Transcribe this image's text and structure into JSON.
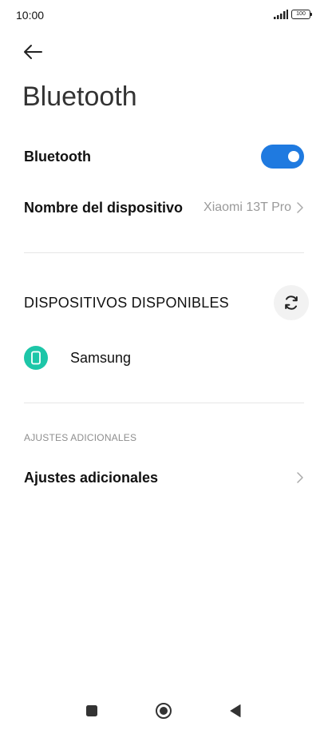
{
  "status_bar": {
    "time": "10:00",
    "battery": "100"
  },
  "page": {
    "title": "Bluetooth"
  },
  "settings": {
    "bluetooth_label": "Bluetooth",
    "bluetooth_enabled": true,
    "device_name_label": "Nombre del dispositivo",
    "device_name_value": "Xiaomi 13T Pro"
  },
  "available_devices": {
    "title": "DISPOSITIVOS DISPONIBLES",
    "devices": [
      {
        "name": "Samsung",
        "icon": "phone-icon"
      }
    ]
  },
  "additional": {
    "subheader": "AJUSTES ADICIONALES",
    "item_label": "Ajustes adicionales"
  },
  "colors": {
    "toggle_on": "#1f7ae0",
    "device_icon_bg": "#1dc6a8"
  }
}
